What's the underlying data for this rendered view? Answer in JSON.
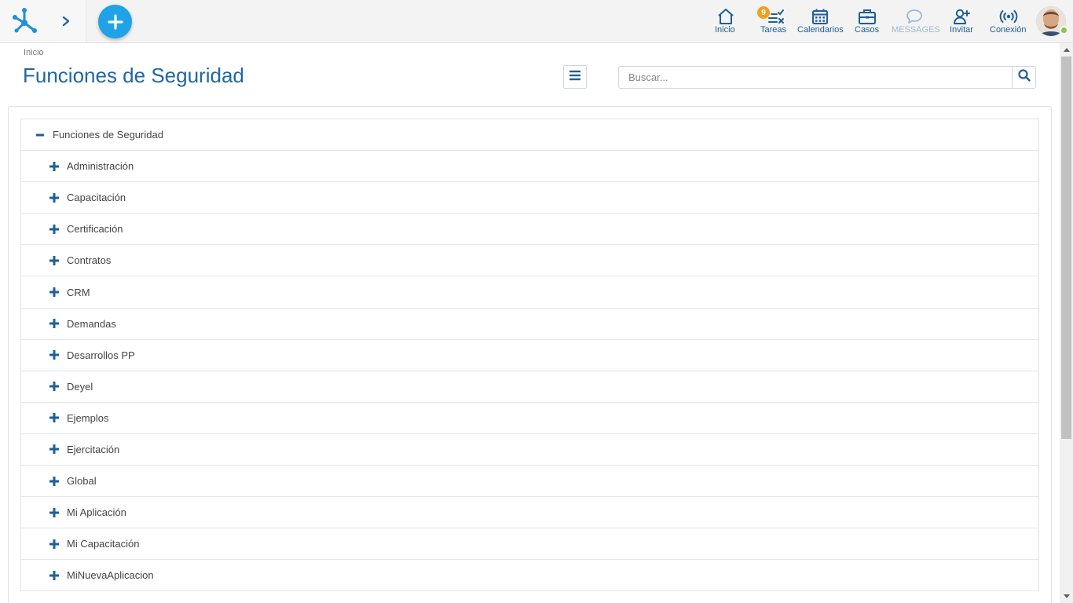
{
  "topbar": {
    "nav": [
      {
        "id": "inicio",
        "label": "Inicio",
        "icon": "home-icon"
      },
      {
        "id": "tareas",
        "label": "Tareas",
        "icon": "tasks-icon",
        "badge": "9"
      },
      {
        "id": "calendarios",
        "label": "Calendarios",
        "icon": "calendar-icon"
      },
      {
        "id": "casos",
        "label": "Casos",
        "icon": "briefcase-icon"
      },
      {
        "id": "messages",
        "label": "MESSAGES",
        "icon": "chat-bubble-icon"
      },
      {
        "id": "invitar",
        "label": "Invitar",
        "icon": "add-user-icon"
      },
      {
        "id": "conexion",
        "label": "Conexión",
        "icon": "broadcast-icon"
      }
    ],
    "status_color": "#8cc640",
    "accent_color": "#1fa3e6"
  },
  "header": {
    "breadcrumb": "Inicio",
    "title": "Funciones de Seguridad",
    "search_placeholder": "Buscar..."
  },
  "tree": {
    "root_label": "Funciones de Seguridad",
    "items": [
      "Administración",
      "Capacitación",
      "Certificación",
      "Contratos",
      "CRM",
      "Demandas",
      "Desarrollos PP",
      "Deyel",
      "Ejemplos",
      "Ejercitación",
      "Global",
      "Mi Aplicación",
      "Mi Capacitación",
      "MiNuevaAplicacion"
    ]
  }
}
